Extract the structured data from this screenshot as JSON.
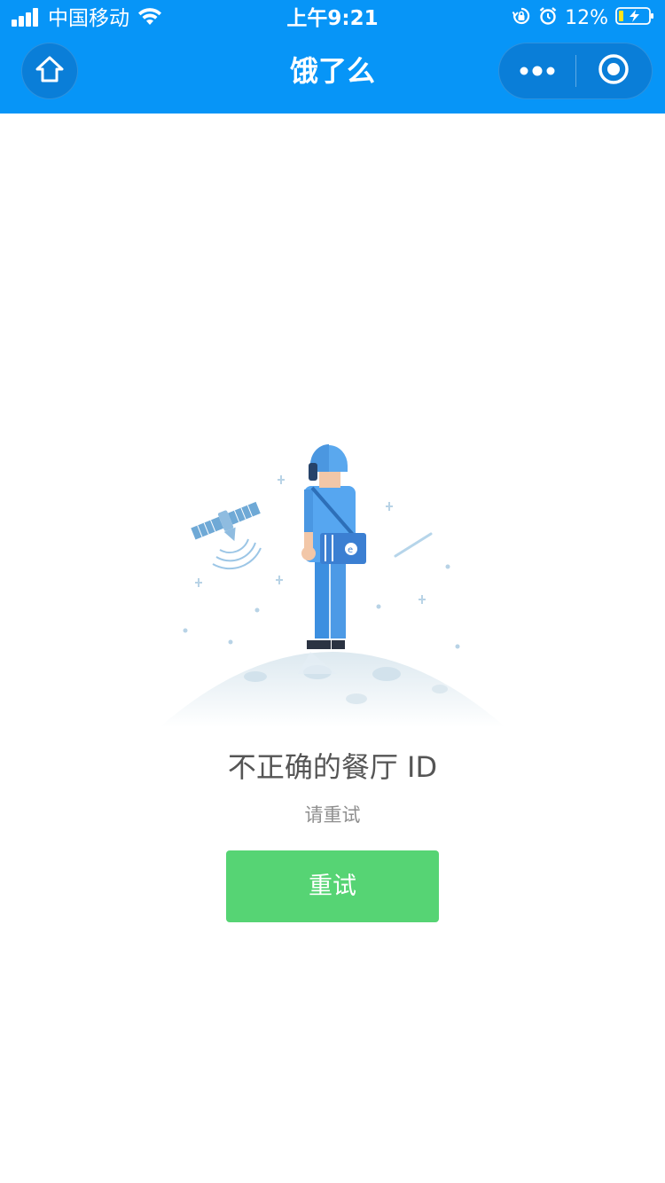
{
  "status_bar": {
    "carrier": "中国移动",
    "time": "上午9:21",
    "battery_percent": "12%",
    "icons": [
      "signal-icon",
      "wifi-icon",
      "orientation-lock-icon",
      "alarm-icon",
      "battery-icon"
    ]
  },
  "nav": {
    "title": "饿了么",
    "home_icon": "home-icon",
    "more_icon": "more-dots-icon",
    "close_icon": "close-circle-icon"
  },
  "error": {
    "title": "不正确的餐厅 ID",
    "subtitle": "请重试",
    "retry_label": "重试"
  },
  "colors": {
    "header_bg": "#0795f7",
    "button_bg": "#56d474",
    "title_text": "#555555",
    "subtitle_text": "#8e8e8e"
  }
}
